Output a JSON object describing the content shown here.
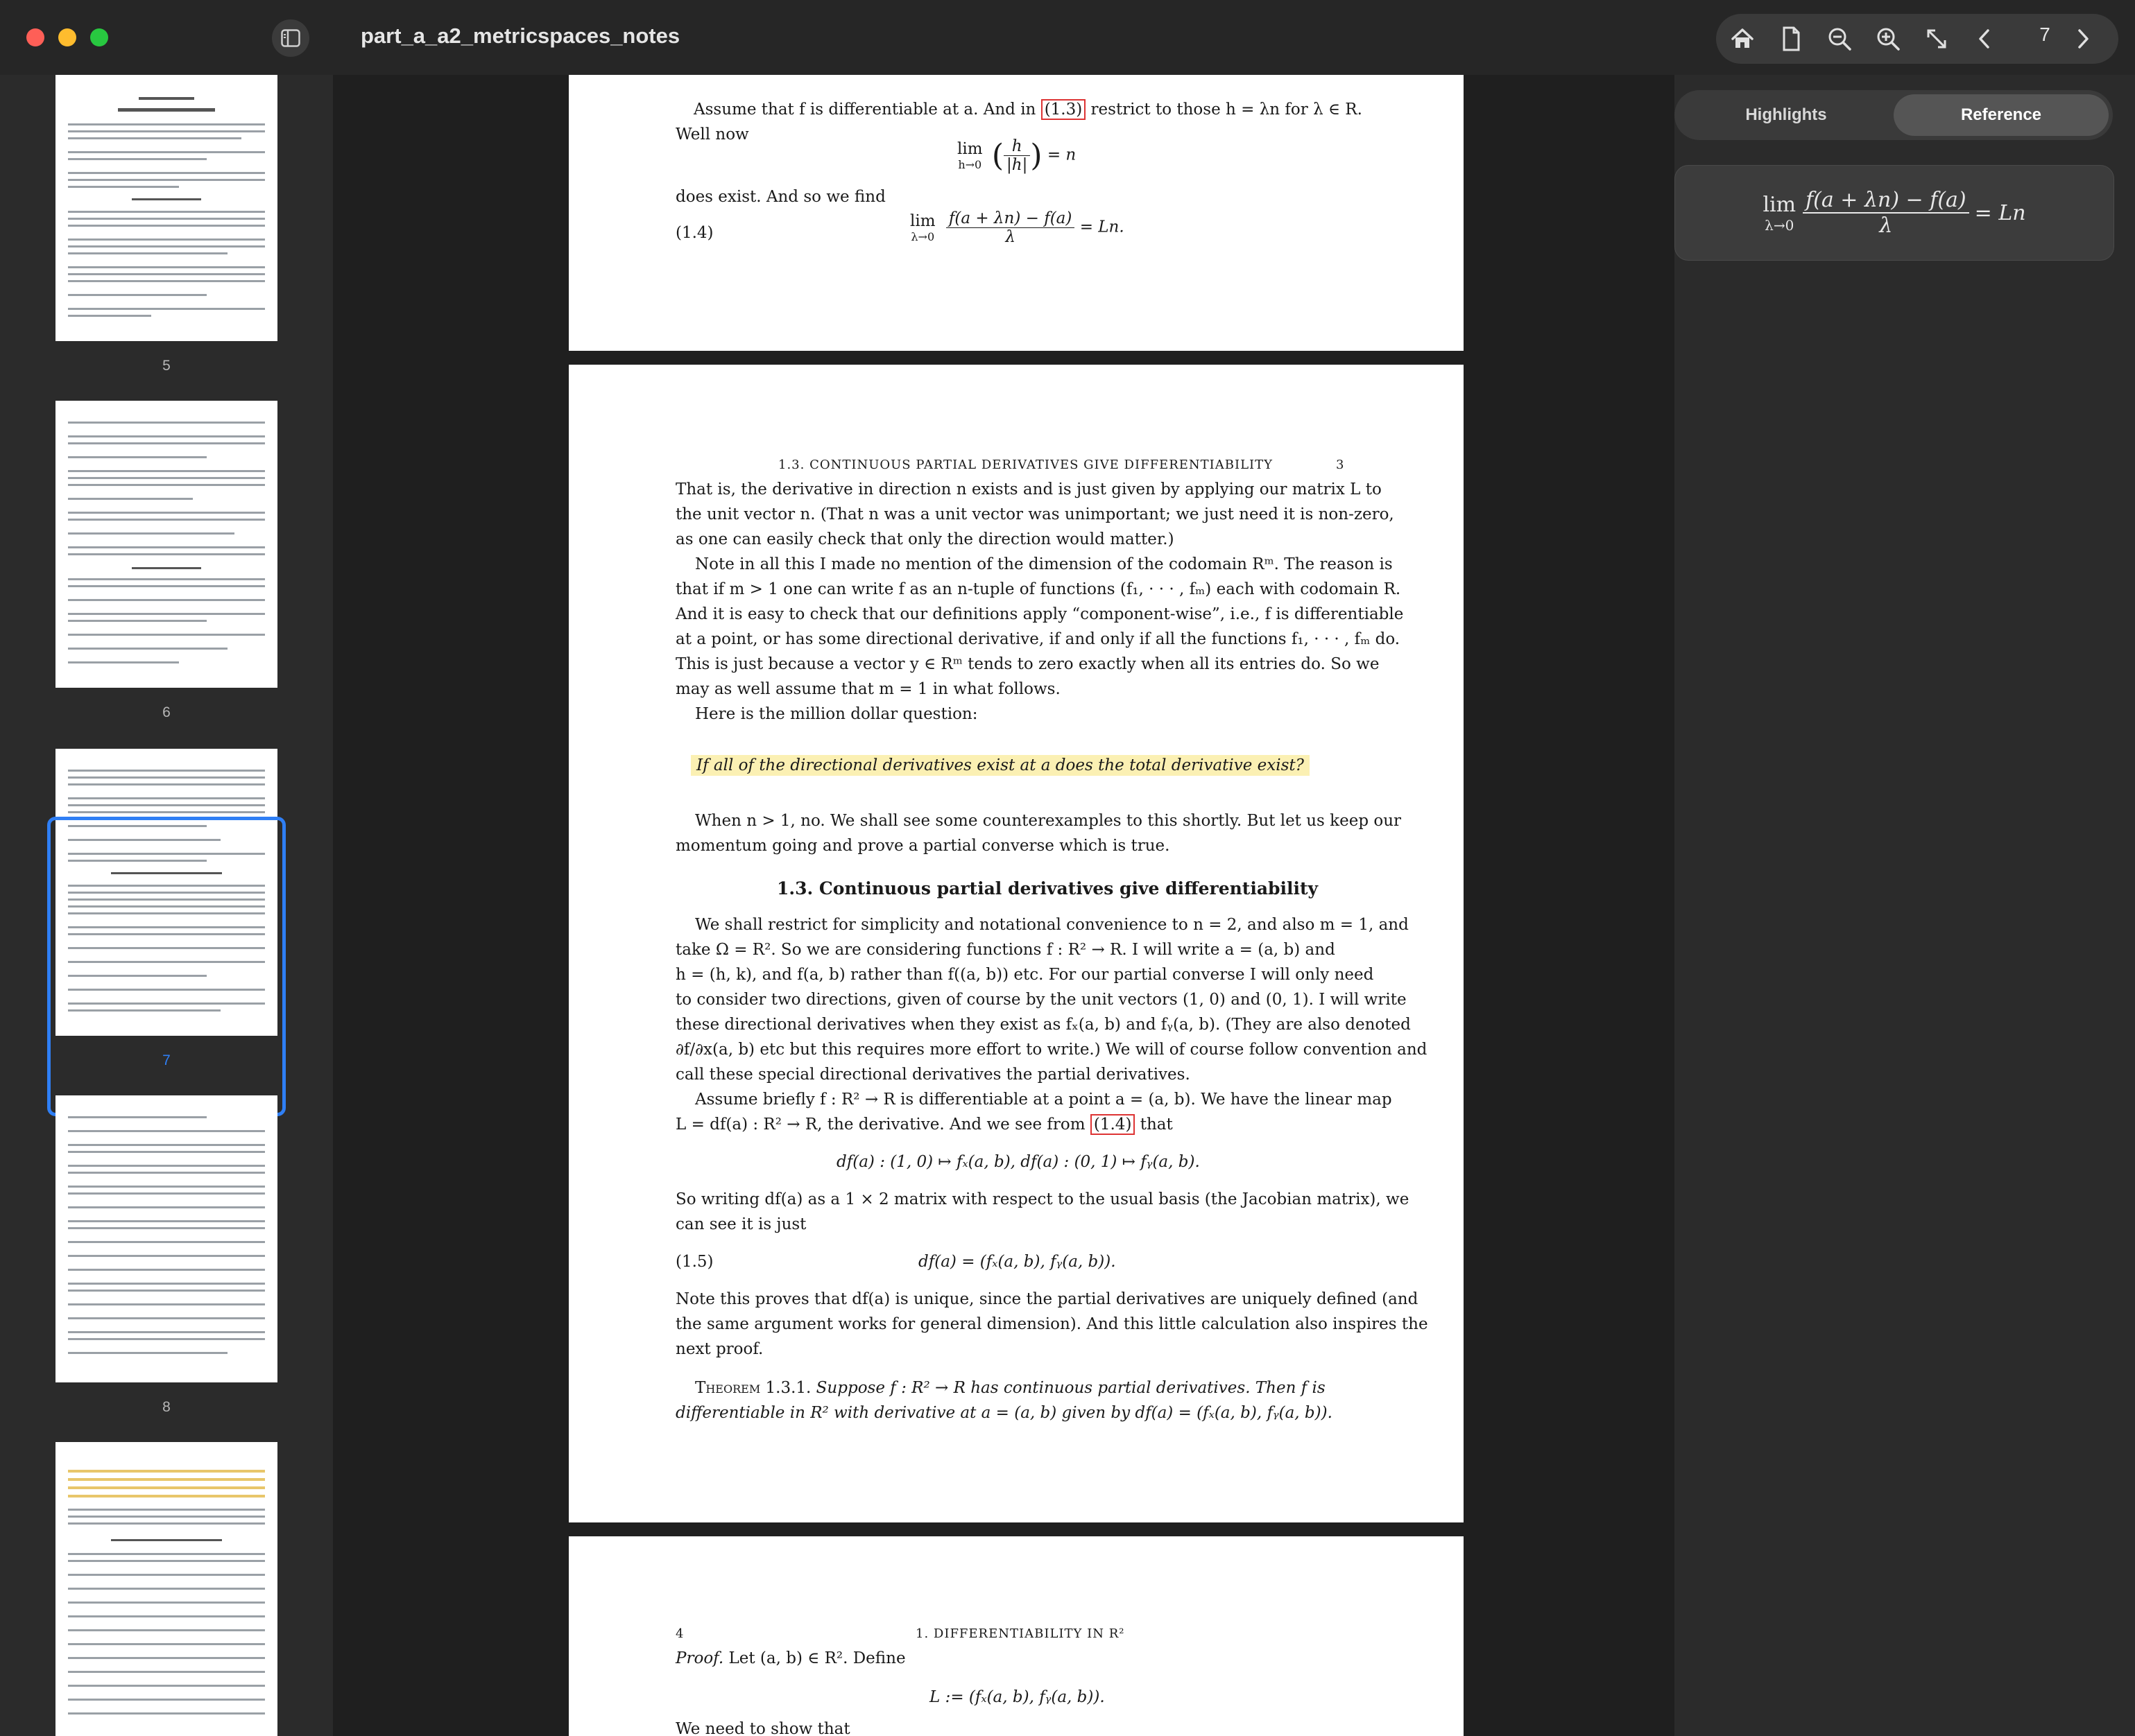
{
  "window": {
    "title": "part_a_a2_metricspaces_notes",
    "traffic_lights": [
      "close",
      "minimize",
      "zoom"
    ]
  },
  "toolbar": {
    "icons": [
      "home-icon",
      "document-icon",
      "zoom-out-icon",
      "zoom-in-icon",
      "resize-icon",
      "chevron-left-icon",
      "chevron-right-icon"
    ],
    "current_page": "7"
  },
  "sidebar": {
    "thumbnails": [
      {
        "label": "5"
      },
      {
        "label": "6"
      },
      {
        "label": "7",
        "selected": true
      },
      {
        "label": "8"
      },
      {
        "label": ""
      }
    ]
  },
  "right_panel": {
    "tabs": [
      {
        "label": "Highlights",
        "active": false
      },
      {
        "label": "Reference",
        "active": true
      }
    ],
    "formula": {
      "lim": "lim",
      "sub": "λ→0",
      "num": "f(a + λn) − f(a)",
      "den": "λ",
      "rhs": "= Ln"
    }
  },
  "document": {
    "top_page": {
      "line1": "Assume that f is differentiable at a. And in",
      "ref1": "(1.3)",
      "line1b": "restrict to those h = λn for λ ∈ R.",
      "line2": "Well now",
      "eq1_lim": "lim",
      "eq1_sub": "h→0",
      "eq1_num": "h",
      "eq1_den": "|h|",
      "eq1_rhs": "= n",
      "line3": "does exist. And so we find",
      "eq_label": "(1.4)",
      "eq2_lim": "lim",
      "eq2_sub": "λ→0",
      "eq2_num": "f(a + λn) − f(a)",
      "eq2_den": "λ",
      "eq2_rhs": "= Ln."
    },
    "main_page": {
      "running_head": "1.3. CONTINUOUS PARTIAL DERIVATIVES GIVE DIFFERENTIABILITY",
      "page_number": "3",
      "para1": [
        "That is, the derivative in direction n exists and is just given by applying our matrix L to",
        "the unit vector n. (That n was a unit vector was unimportant; we just need it is non-zero,",
        "as one can easily check that only the direction would matter.)"
      ],
      "para2": [
        "Note in all this I made no mention of the dimension of the codomain Rᵐ. The reason is",
        "that if m > 1 one can write f as an n-tuple of functions (f₁, · · · , fₘ) each with codomain R.",
        "And it is easy to check that our definitions apply “component-wise”, i.e., f is differentiable",
        "at a point, or has some directional derivative, if and only if all the functions f₁, · · · , fₘ do.",
        "This is just because a vector y ∈ Rᵐ tends to zero exactly when all its entries do. So we",
        "may as well assume that m = 1 in what follows."
      ],
      "para2_end": "Here is the million dollar question:",
      "highlight": "If all of the directional derivatives exist at a does the total derivative exist?",
      "para3": [
        "When n > 1, no. We shall see some counterexamples to this shortly. But let us keep our",
        "momentum going and prove a partial converse which is true."
      ],
      "section_heading": "1.3. Continuous partial derivatives give differentiability",
      "para4": [
        "We shall restrict for simplicity and notational convenience to n = 2, and also m = 1, and",
        "take Ω = R². So we are considering functions f : R² → R. I will write a = (a, b) and",
        "h = (h, k), and f(a, b) rather than f((a, b)) etc. For our partial converse I will only need",
        "to consider two directions, given of course by the unit vectors (1, 0) and (0, 1). I will write",
        "these directional derivatives when they exist as fₓ(a, b) and fᵧ(a, b). (They are also denoted",
        "∂f/∂x(a, b) etc but this requires more effort to write.) We will of course follow convention and",
        "call these special directional derivatives the partial derivatives."
      ],
      "para5a": "Assume briefly f : R² → R is differentiable at a point a = (a, b). We have the linear map",
      "para5b": "L = df(a) : R² → R, the derivative. And we see from",
      "para5b_ref": "(1.4)",
      "para5b_end": "that",
      "eq3": "df(a) : (1, 0) ↦ fₓ(a, b), df(a) : (0, 1) ↦ fᵧ(a, b).",
      "para6": [
        "So writing df(a) as a 1 × 2 matrix with respect to the usual basis (the Jacobian matrix), we",
        "can see it is just"
      ],
      "eq4_label": "(1.5)",
      "eq4": "df(a) = (fₓ(a, b), fᵧ(a, b)).",
      "para7": [
        "Note this proves that df(a) is unique, since the partial derivatives are uniquely defined (and",
        "the same argument works for general dimension). And this little calculation also inspires the",
        "next proof."
      ],
      "theorem_label": "Theorem 1.3.1.",
      "theorem_line1": "Suppose f : R² → R has continuous partial derivatives. Then f is",
      "theorem_line2": "differentiable in R² with derivative at a = (a, b) given by df(a) = (fₓ(a, b), fᵧ(a, b))."
    },
    "bottom_page": {
      "page_number": "4",
      "running_head": "1. DIFFERENTIABILITY IN R²",
      "proof_label": "Proof.",
      "proof_text": "Let (a, b) ∈ R². Define",
      "eq5": "L := (fₓ(a, b), fᵧ(a, b)).",
      "line_cut": "We need to show that"
    }
  }
}
